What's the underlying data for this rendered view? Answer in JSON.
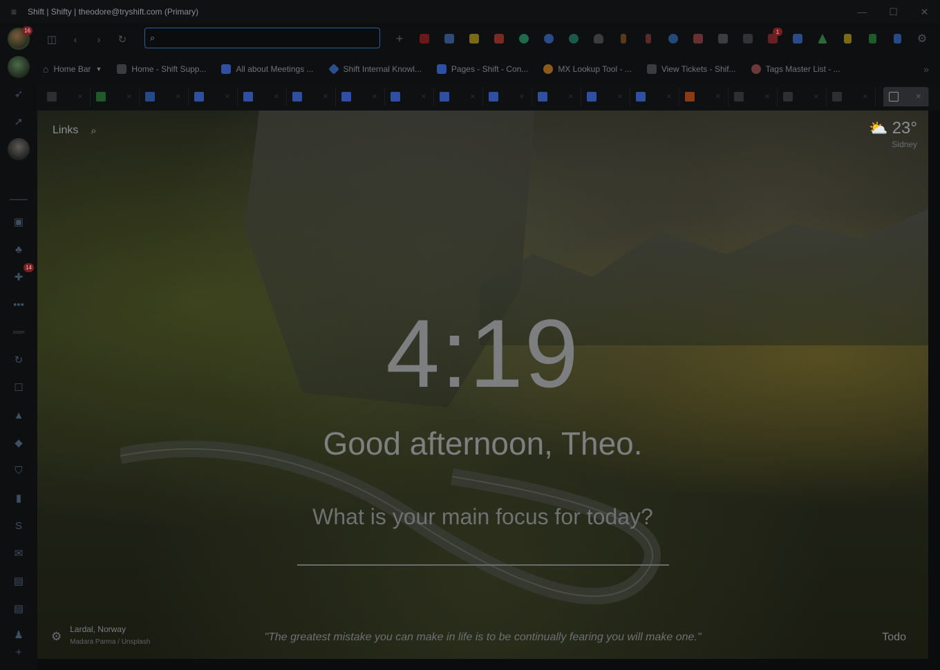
{
  "window": {
    "title": "Shift | Shifty | theodore@tryshift.com (Primary)",
    "controls": [
      "—",
      "☐",
      "✕"
    ]
  },
  "rail": {
    "profile_badge": "16",
    "slack_badge": "14",
    "zoom_label": "zoom"
  },
  "toolbar": {
    "search_value": "",
    "gmail_badge": "1"
  },
  "bookmarks": [
    {
      "label": "Home Bar",
      "color": "#2c2e31"
    },
    {
      "label": "Home - Shift Supp...",
      "color": "#3a3c40"
    },
    {
      "label": "All about Meetings ...",
      "color": "#2f4fa3"
    },
    {
      "label": "Shift Internal Knowl...",
      "color": "#2b4f8f"
    },
    {
      "label": "Pages - Shift - Con...",
      "color": "#2f4fa3"
    },
    {
      "label": "MX Lookup Tool - ...",
      "color": "#8a5a1f"
    },
    {
      "label": "View Tickets - Shif...",
      "color": "#3a3c40"
    },
    {
      "label": "Tags Master List - ...",
      "color": "#6a3a3a"
    }
  ],
  "content": {
    "links_label": "Links",
    "temperature": "23°",
    "city": "Sidney",
    "time": "4:19",
    "greeting": "Good afternoon, Theo.",
    "focus_prompt": "What is your main focus for today?",
    "location": "Lardal, Norway",
    "photo_credit": "Madara Parma / Unsplash",
    "quote": "\"The greatest mistake you can make in life is to be continually fearing you will make one.\"",
    "todo_label": "Todo"
  }
}
